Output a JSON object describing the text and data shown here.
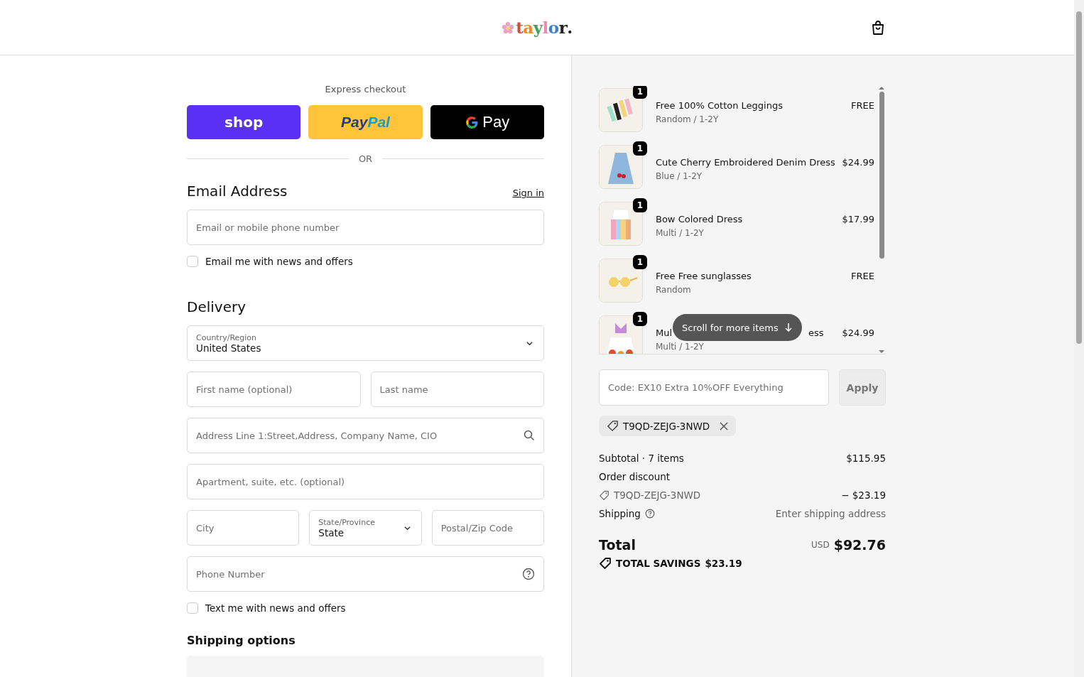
{
  "header": {
    "logo": [
      {
        "text": "t",
        "color": "#d8473a"
      },
      {
        "text": "a",
        "color": "#f08a24"
      },
      {
        "text": "y",
        "color": "#3aa657"
      },
      {
        "text": "l",
        "color": "#e98bb5"
      },
      {
        "text": "o",
        "color": "#3b7fd0"
      },
      {
        "text": "r",
        "color": "#222222"
      },
      {
        "text": ".",
        "color": "#222222"
      }
    ]
  },
  "express": {
    "title": "Express checkout",
    "buttons": [
      {
        "kind": "shop",
        "label": "shop"
      },
      {
        "kind": "paypal",
        "label": "Pay",
        "label2": "Pal"
      },
      {
        "kind": "gpay",
        "label": "Pay"
      }
    ],
    "or": "OR"
  },
  "contact": {
    "title": "Email Address",
    "sign_in": "Sign in",
    "email": {
      "placeholder": "Email or mobile phone number"
    },
    "news": {
      "label": "Email me with news and offers",
      "checked": false
    }
  },
  "delivery": {
    "title": "Delivery",
    "rows": [
      [
        {
          "kind": "select",
          "label": "Country/Region",
          "value": "United States"
        }
      ],
      [
        {
          "kind": "text",
          "placeholder": "First name (optional)"
        },
        {
          "kind": "text",
          "placeholder": "Last name"
        }
      ],
      [
        {
          "kind": "search",
          "placeholder": "Address Line 1:Street,Address, Company Name, CIO"
        }
      ],
      [
        {
          "kind": "text",
          "placeholder": "Apartment, suite, etc. (optional)"
        }
      ],
      [
        {
          "kind": "text",
          "placeholder": "City"
        },
        {
          "kind": "select",
          "label": "State/Province",
          "value": "State"
        },
        {
          "kind": "text",
          "placeholder": "Postal/Zip Code"
        }
      ],
      [
        {
          "kind": "help",
          "placeholder": "Phone Number"
        }
      ]
    ],
    "sms": {
      "label": "Text me with news and offers",
      "checked": false
    }
  },
  "shipping_options": {
    "title": "Shipping options"
  },
  "cart": {
    "items": [
      {
        "name": "Free 100% Cotton Leggings",
        "variant": "Random / 1-2Y",
        "price": "FREE",
        "qty": "1",
        "kind": "leggings"
      },
      {
        "name": "Cute Cherry Embroidered Denim Dress",
        "variant": "Blue / 1-2Y",
        "price": "$24.99",
        "qty": "1",
        "kind": "denim"
      },
      {
        "name": "Bow Colored Dress",
        "variant": "Multi / 1-2Y",
        "price": "$17.99",
        "qty": "1",
        "kind": "rainbow"
      },
      {
        "name": "Free Free sunglasses",
        "variant": "Random",
        "price": "FREE",
        "qty": "1",
        "kind": "sunglasses"
      },
      {
        "name": "Mul",
        "name_end": "ess",
        "variant": "Multi / 1-2Y",
        "price": "$24.99",
        "qty": "1",
        "kind": "butterfly"
      }
    ],
    "scroll_hint": "Scroll for more items"
  },
  "discount": {
    "placeholder": "Code: EX10 Extra 10%OFF Everything",
    "apply": "Apply",
    "tag": "T9QD-ZEJG-3NWD"
  },
  "summary": {
    "subtotal_label": "Subtotal · 7 items",
    "subtotal": "$115.95",
    "discount_label": "Order discount",
    "discount_code": "T9QD-ZEJG-3NWD",
    "discount": "− $23.19",
    "shipping_label": "Shipping",
    "shipping": "Enter shipping address",
    "total_label": "Total",
    "currency": "USD",
    "total": "$92.76",
    "savings_label": "TOTAL SAVINGS",
    "savings": "$23.19"
  }
}
